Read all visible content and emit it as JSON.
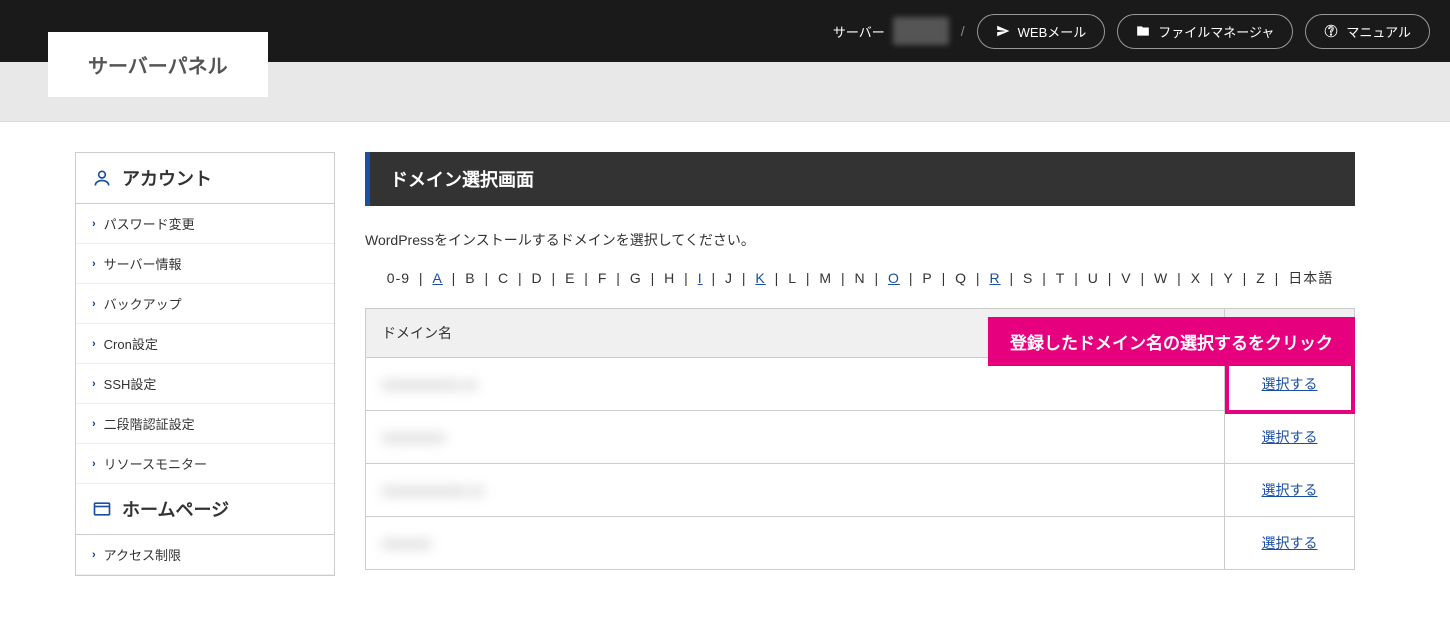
{
  "header": {
    "logo": "サーバーパネル",
    "server_label_prefix": "サーバー",
    "webmail": "WEBメール",
    "filemanager": "ファイルマネージャ",
    "manual": "マニュアル"
  },
  "sidebar": {
    "sections": [
      {
        "title": "アカウント",
        "icon": "user",
        "items": [
          "パスワード変更",
          "サーバー情報",
          "バックアップ",
          "Cron設定",
          "SSH設定",
          "二段階認証設定",
          "リソースモニター"
        ]
      },
      {
        "title": "ホームページ",
        "icon": "window",
        "items": [
          "アクセス制限"
        ]
      }
    ]
  },
  "main": {
    "page_title": "ドメイン選択画面",
    "instruction": "WordPressをインストールするドメインを選択してください。",
    "alpha_prefix": "0-9",
    "alpha_active": [
      "A",
      "I",
      "K",
      "O",
      "R"
    ],
    "alpha_all": [
      "A",
      "B",
      "C",
      "D",
      "E",
      "F",
      "G",
      "H",
      "I",
      "J",
      "K",
      "L",
      "M",
      "N",
      "O",
      "P",
      "Q",
      "R",
      "S",
      "T",
      "U",
      "V",
      "W",
      "X",
      "Y",
      "Z"
    ],
    "alpha_suffix": "日本語",
    "table": {
      "header_domain": "ドメイン名",
      "select_label": "選択する",
      "rows": [
        {
          "domain_masked": "xxxxxxxxxxx.xx"
        },
        {
          "domain_masked": "xxxxxxxxx"
        },
        {
          "domain_masked": "xxxxxxxxxxxx.xx"
        },
        {
          "domain_masked": "xxxxxxx"
        }
      ]
    }
  },
  "annotation": {
    "callout_text": "登録したドメイン名の選択するをクリック"
  }
}
